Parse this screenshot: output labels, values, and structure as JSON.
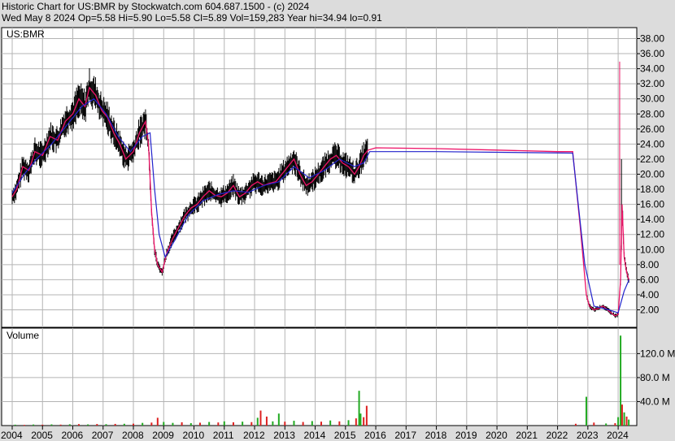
{
  "header": {
    "line1": "Historic Chart for US:BMR by Stockwatch.com 604.687.1500 - (c) 2024",
    "line2": "Wed May  8 2024   Op=5.58  Hi=5.90  Lo=5.58  Cl=5.89  Vol=159,283  Year hi=34.94  lo=0.91"
  },
  "colors": {
    "background": "#dcdcdc",
    "panel": "#ffffff",
    "grid": "#b4b4b4",
    "price_bar": "#000000",
    "ma_short": "#ee1166",
    "ma_long": "#2222cc",
    "ma_mix": "#9933cc",
    "volume_up": "#22aa22",
    "volume_down": "#dd2222"
  },
  "chart_data": {
    "type": "line",
    "symbol_label": "US:BMR",
    "volume_label": "Volume",
    "x_tick_labels": [
      "2004",
      "2005",
      "2006",
      "2007",
      "2008",
      "2009",
      "2010",
      "2011",
      "2012",
      "2013",
      "2014",
      "2015",
      "2016",
      "2017",
      "2018",
      "2019",
      "2020",
      "2021",
      "2022",
      "2023",
      "2024"
    ],
    "xlim": [
      2004.0,
      2024.4
    ],
    "price_axis": {
      "ylim": [
        0,
        39
      ],
      "tick_labels": [
        "2.00",
        "4.00",
        "6.00",
        "8.00",
        "10.00",
        "12.00",
        "14.00",
        "16.00",
        "18.00",
        "20.00",
        "22.00",
        "24.00",
        "26.00",
        "28.00",
        "30.00",
        "32.00",
        "34.00",
        "36.00",
        "38.00"
      ],
      "tick_values": [
        2,
        4,
        6,
        8,
        10,
        12,
        14,
        16,
        18,
        20,
        22,
        24,
        26,
        28,
        30,
        32,
        34,
        36,
        38
      ]
    },
    "volume_axis": {
      "ylim": [
        0,
        150
      ],
      "unit": "M",
      "tick_labels": [
        "40.0 M",
        "80.0 M",
        "120.0 M"
      ],
      "tick_values": [
        40,
        80,
        120
      ]
    },
    "price_series": [
      [
        2004.0,
        17.0
      ],
      [
        2004.15,
        18.0
      ],
      [
        2004.35,
        21.0
      ],
      [
        2004.55,
        20.5
      ],
      [
        2004.75,
        23.0
      ],
      [
        2005.0,
        22.5
      ],
      [
        2005.25,
        25.0
      ],
      [
        2005.5,
        24.5
      ],
      [
        2005.75,
        27.0
      ],
      [
        2006.0,
        28.0
      ],
      [
        2006.2,
        30.0
      ],
      [
        2006.4,
        29.0
      ],
      [
        2006.55,
        31.5
      ],
      [
        2006.75,
        30.5
      ],
      [
        2006.95,
        28.5
      ],
      [
        2007.15,
        27.5
      ],
      [
        2007.35,
        25.5
      ],
      [
        2007.55,
        24.0
      ],
      [
        2007.75,
        22.0
      ],
      [
        2008.0,
        23.0
      ],
      [
        2008.2,
        25.5
      ],
      [
        2008.4,
        27.0
      ],
      [
        2008.5,
        24.0
      ],
      [
        2008.6,
        15.0
      ],
      [
        2008.7,
        10.0
      ],
      [
        2008.8,
        8.0
      ],
      [
        2008.95,
        7.0
      ],
      [
        2009.1,
        9.5
      ],
      [
        2009.3,
        11.5
      ],
      [
        2009.5,
        13.0
      ],
      [
        2009.7,
        14.5
      ],
      [
        2009.9,
        15.5
      ],
      [
        2010.1,
        16.0
      ],
      [
        2010.3,
        17.0
      ],
      [
        2010.5,
        17.8
      ],
      [
        2010.7,
        17.2
      ],
      [
        2010.9,
        17.0
      ],
      [
        2011.1,
        17.5
      ],
      [
        2011.3,
        18.5
      ],
      [
        2011.5,
        17.0
      ],
      [
        2011.7,
        17.5
      ],
      [
        2011.9,
        18.5
      ],
      [
        2012.1,
        19.0
      ],
      [
        2012.3,
        18.5
      ],
      [
        2012.5,
        18.8
      ],
      [
        2012.7,
        19.0
      ],
      [
        2012.9,
        20.0
      ],
      [
        2013.1,
        21.0
      ],
      [
        2013.3,
        22.0
      ],
      [
        2013.5,
        20.0
      ],
      [
        2013.7,
        18.5
      ],
      [
        2013.9,
        19.0
      ],
      [
        2014.1,
        20.0
      ],
      [
        2014.3,
        21.0
      ],
      [
        2014.5,
        22.0
      ],
      [
        2014.7,
        22.5
      ],
      [
        2014.9,
        21.5
      ],
      [
        2015.1,
        21.0
      ],
      [
        2015.3,
        20.0
      ],
      [
        2015.45,
        21.0
      ],
      [
        2015.6,
        22.5
      ],
      [
        2015.75,
        23.2
      ],
      [
        2016.0,
        23.5
      ],
      [
        2018.0,
        23.4
      ],
      [
        2020.0,
        23.2
      ],
      [
        2022.0,
        23.0
      ],
      [
        2022.5,
        23.0
      ],
      [
        2022.75,
        13.0
      ],
      [
        2022.95,
        4.0
      ],
      [
        2023.05,
        2.5
      ],
      [
        2023.2,
        2.0
      ],
      [
        2023.35,
        2.2
      ],
      [
        2023.5,
        2.5
      ],
      [
        2023.65,
        2.0
      ],
      [
        2023.8,
        1.5
      ],
      [
        2023.9,
        1.2
      ],
      [
        2024.0,
        1.4
      ],
      [
        2024.08,
        6.0
      ],
      [
        2024.13,
        16.0
      ],
      [
        2024.2,
        9.0
      ],
      [
        2024.28,
        7.0
      ],
      [
        2024.36,
        5.9
      ]
    ],
    "price_series_long": [
      [
        2004.0,
        17.5
      ],
      [
        2004.4,
        20.0
      ],
      [
        2004.8,
        22.0
      ],
      [
        2005.3,
        24.0
      ],
      [
        2005.8,
        26.5
      ],
      [
        2006.3,
        29.0
      ],
      [
        2006.7,
        30.0
      ],
      [
        2007.1,
        28.0
      ],
      [
        2007.5,
        25.0
      ],
      [
        2007.9,
        23.0
      ],
      [
        2008.3,
        25.0
      ],
      [
        2008.55,
        25.5
      ],
      [
        2008.7,
        18.0
      ],
      [
        2008.85,
        12.0
      ],
      [
        2009.05,
        9.0
      ],
      [
        2009.4,
        11.5
      ],
      [
        2009.8,
        14.5
      ],
      [
        2010.3,
        16.5
      ],
      [
        2010.8,
        17.3
      ],
      [
        2011.3,
        17.8
      ],
      [
        2011.8,
        17.6
      ],
      [
        2012.3,
        18.5
      ],
      [
        2012.8,
        19.0
      ],
      [
        2013.3,
        21.0
      ],
      [
        2013.8,
        19.5
      ],
      [
        2014.3,
        20.5
      ],
      [
        2014.8,
        22.0
      ],
      [
        2015.3,
        21.0
      ],
      [
        2015.6,
        21.5
      ],
      [
        2015.8,
        23.0
      ],
      [
        2018.0,
        23.0
      ],
      [
        2022.5,
        22.8
      ],
      [
        2022.9,
        8.0
      ],
      [
        2023.2,
        2.5
      ],
      [
        2023.7,
        2.0
      ],
      [
        2024.0,
        1.6
      ],
      [
        2024.2,
        4.5
      ],
      [
        2024.36,
        6.0
      ]
    ],
    "volume_series": [
      [
        2004.1,
        1.5,
        1
      ],
      [
        2004.4,
        1.2,
        0
      ],
      [
        2004.7,
        1.8,
        1
      ],
      [
        2005.0,
        1.5,
        0
      ],
      [
        2005.3,
        2.0,
        1
      ],
      [
        2005.6,
        1.6,
        0
      ],
      [
        2005.9,
        2.2,
        1
      ],
      [
        2006.2,
        2.5,
        0
      ],
      [
        2006.5,
        2.0,
        1
      ],
      [
        2006.8,
        2.6,
        0
      ],
      [
        2007.1,
        2.3,
        1
      ],
      [
        2007.4,
        2.8,
        0
      ],
      [
        2007.7,
        3.0,
        1
      ],
      [
        2008.0,
        3.2,
        0
      ],
      [
        2008.3,
        4.5,
        1
      ],
      [
        2008.6,
        5.0,
        0
      ],
      [
        2008.8,
        13.0,
        0
      ],
      [
        2009.0,
        6.0,
        1
      ],
      [
        2009.3,
        4.5,
        1
      ],
      [
        2009.6,
        5.5,
        0
      ],
      [
        2009.9,
        4.0,
        1
      ],
      [
        2010.2,
        4.8,
        0
      ],
      [
        2010.5,
        6.0,
        1
      ],
      [
        2010.8,
        5.2,
        0
      ],
      [
        2011.0,
        7.0,
        1
      ],
      [
        2011.3,
        5.5,
        0
      ],
      [
        2011.6,
        6.5,
        1
      ],
      [
        2011.9,
        5.8,
        0
      ],
      [
        2012.1,
        13.0,
        1
      ],
      [
        2012.2,
        25.0,
        0
      ],
      [
        2012.4,
        15.0,
        0
      ],
      [
        2012.6,
        7.0,
        1
      ],
      [
        2012.8,
        20.0,
        1
      ],
      [
        2013.0,
        6.5,
        0
      ],
      [
        2013.3,
        8.0,
        1
      ],
      [
        2013.6,
        6.0,
        0
      ],
      [
        2013.9,
        7.5,
        1
      ],
      [
        2014.2,
        6.5,
        0
      ],
      [
        2014.5,
        8.5,
        1
      ],
      [
        2014.8,
        7.0,
        0
      ],
      [
        2015.1,
        9.0,
        1
      ],
      [
        2015.35,
        12.0,
        0
      ],
      [
        2015.45,
        58.0,
        1
      ],
      [
        2015.5,
        20.0,
        1
      ],
      [
        2015.6,
        14.0,
        0
      ],
      [
        2015.7,
        33.0,
        0
      ],
      [
        2022.6,
        3.0,
        0
      ],
      [
        2022.95,
        48.0,
        1
      ],
      [
        2023.2,
        5.0,
        0
      ],
      [
        2023.6,
        3.5,
        1
      ],
      [
        2023.9,
        4.0,
        0
      ],
      [
        2024.0,
        14.0,
        1
      ],
      [
        2024.08,
        150.0,
        1
      ],
      [
        2024.13,
        35.0,
        0
      ],
      [
        2024.2,
        22.0,
        1
      ],
      [
        2024.28,
        15.0,
        0
      ],
      [
        2024.35,
        10.0,
        1
      ]
    ]
  }
}
